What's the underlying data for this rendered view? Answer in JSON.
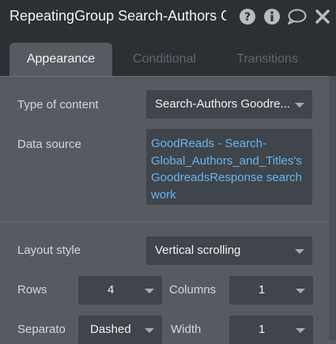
{
  "header": {
    "title": "RepeatingGroup Search-Authors Goodreads"
  },
  "tabs": [
    {
      "label": "Appearance"
    },
    {
      "label": "Conditional"
    },
    {
      "label": "Transitions"
    }
  ],
  "appearance": {
    "type_of_content": {
      "label": "Type of content",
      "value": "Search-Authors Goodre..."
    },
    "data_source": {
      "label": "Data source",
      "value": "GoodReads - Search-Global_Authors_and_Titles's GoodreadsResponse search work"
    },
    "layout_style": {
      "label": "Layout style",
      "value": "Vertical scrolling"
    },
    "rows": {
      "label": "Rows",
      "value": "4"
    },
    "columns": {
      "label": "Columns",
      "value": "1"
    },
    "separator": {
      "label": "Separato",
      "value": "Dashed"
    },
    "width": {
      "label": "Width",
      "value": "1"
    }
  },
  "icons": {
    "help": "help-icon",
    "info": "info-icon",
    "comment": "comment-icon",
    "close": "close-icon"
  }
}
